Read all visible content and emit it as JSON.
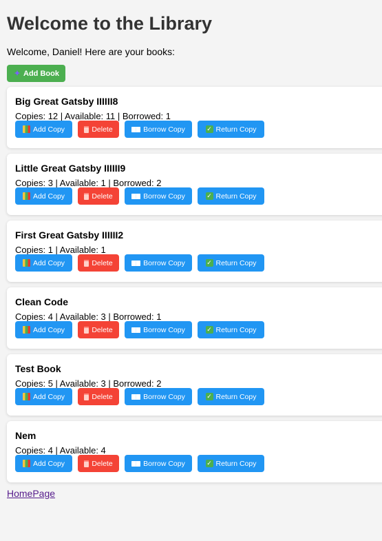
{
  "page": {
    "title": "Welcome to the Library",
    "welcome_text": "Welcome, Daniel! Here are your books:",
    "add_book_label": "Add Book",
    "home_link_label": "HomePage"
  },
  "buttons": {
    "add_copy_label": "Add Copy",
    "delete_label": "Delete",
    "borrow_copy_label": "Borrow Copy",
    "return_copy_label": "Return Copy"
  },
  "icons": {
    "add_book": "sparkle-icon",
    "add_copy": "books-icon",
    "delete": "trash-icon",
    "borrow_copy": "open-book-icon",
    "return_copy": "check-mark-icon"
  },
  "colors": {
    "primary": "#2196f3",
    "danger": "#f44336",
    "success": "#4caf50",
    "link": "#551a8b"
  },
  "books": [
    {
      "title": "Big Great Gatsby IIIIII8",
      "stats": "Copies: 12 | Available: 11 | Borrowed: 1"
    },
    {
      "title": "Little Great Gatsby IIIIII9",
      "stats": "Copies: 3 | Available: 1 | Borrowed: 2"
    },
    {
      "title": "First Great Gatsby IIIIII2",
      "stats": "Copies: 1 | Available: 1"
    },
    {
      "title": "Clean Code",
      "stats": "Copies: 4 | Available: 3 | Borrowed: 1"
    },
    {
      "title": "Test Book",
      "stats": "Copies: 5 | Available: 3 | Borrowed: 2"
    },
    {
      "title": "Nem",
      "stats": "Copies: 4 | Available: 4"
    }
  ]
}
